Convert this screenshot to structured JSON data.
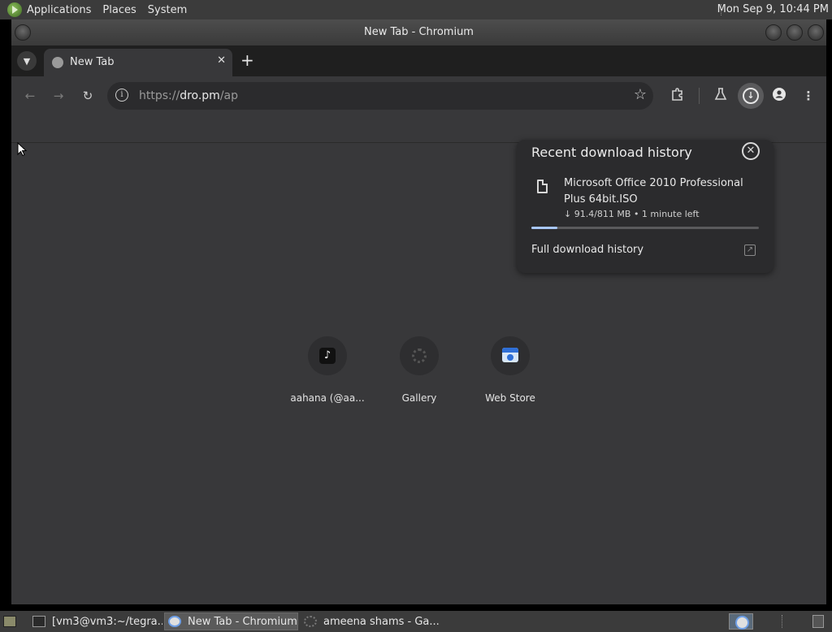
{
  "top_panel": {
    "menus": [
      "Applications",
      "Places",
      "System"
    ],
    "clock": "Mon Sep  9, 10:44 PM"
  },
  "window": {
    "title": "New Tab - Chromium"
  },
  "tabs": [
    {
      "label": "New Tab",
      "close": "✕"
    }
  ],
  "new_tab_symbol": "+",
  "toolbar": {
    "url_scheme": "https://",
    "url_host": "dro.pm",
    "url_path": "/ap",
    "icons": [
      "back-arrow-icon",
      "forward-arrow-icon",
      "reload-icon",
      "site-info-icon",
      "bookmark-star-icon",
      "extensions-icon",
      "labs-flask-icon",
      "download-icon",
      "profile-icon",
      "kebab-menu-icon"
    ]
  },
  "download_popup": {
    "heading": "Recent download history",
    "file_name": "Microsoft Office 2010 Professional Plus 64bit.ISO",
    "status": "↓ 91.4/811 MB • 1 minute left",
    "progress_fraction": 0.113,
    "full_history_label": "Full download history"
  },
  "shortcuts": [
    {
      "name": "aahana (@aa...",
      "icon": "tiktok-icon"
    },
    {
      "name": "Gallery",
      "icon": "gallery-icon"
    },
    {
      "name": "Web Store",
      "icon": "web-store-icon"
    }
  ],
  "taskbar": {
    "tasks": [
      {
        "label": "[vm3@vm3:~/tegra...",
        "icon": "terminal-icon"
      },
      {
        "label": "New Tab - Chromium",
        "icon": "chromium-icon"
      },
      {
        "label": "ameena shams - Ga...",
        "icon": "gallery-icon"
      }
    ]
  },
  "colors": {
    "progress_fill": "#a8c7fa",
    "page_background": "#38383a",
    "popup_background": "#2b2b2d"
  }
}
